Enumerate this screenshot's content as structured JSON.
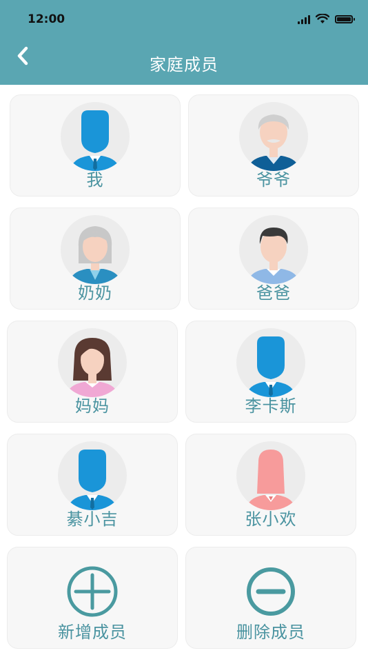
{
  "status_bar": {
    "time": "12:00"
  },
  "header": {
    "title": "家庭成员"
  },
  "members": [
    {
      "name": "我",
      "avatar": "man-silhouette-avatar-icon"
    },
    {
      "name": "爷爷",
      "avatar": "grandpa-avatar-icon"
    },
    {
      "name": "奶奶",
      "avatar": "grandma-avatar-icon"
    },
    {
      "name": "爸爸",
      "avatar": "dad-avatar-icon"
    },
    {
      "name": "妈妈",
      "avatar": "mom-avatar-icon"
    },
    {
      "name": "李卡斯",
      "avatar": "man-silhouette-avatar-icon"
    },
    {
      "name": "綦小吉",
      "avatar": "man-silhouette-avatar-icon"
    },
    {
      "name": "张小欢",
      "avatar": "woman-silhouette-avatar-icon"
    }
  ],
  "actions": {
    "add": "新增成员",
    "delete": "删除成员"
  },
  "colors": {
    "header": "#5aa6b2",
    "accent": "#4a93a0",
    "card": "#f7f7f7"
  }
}
